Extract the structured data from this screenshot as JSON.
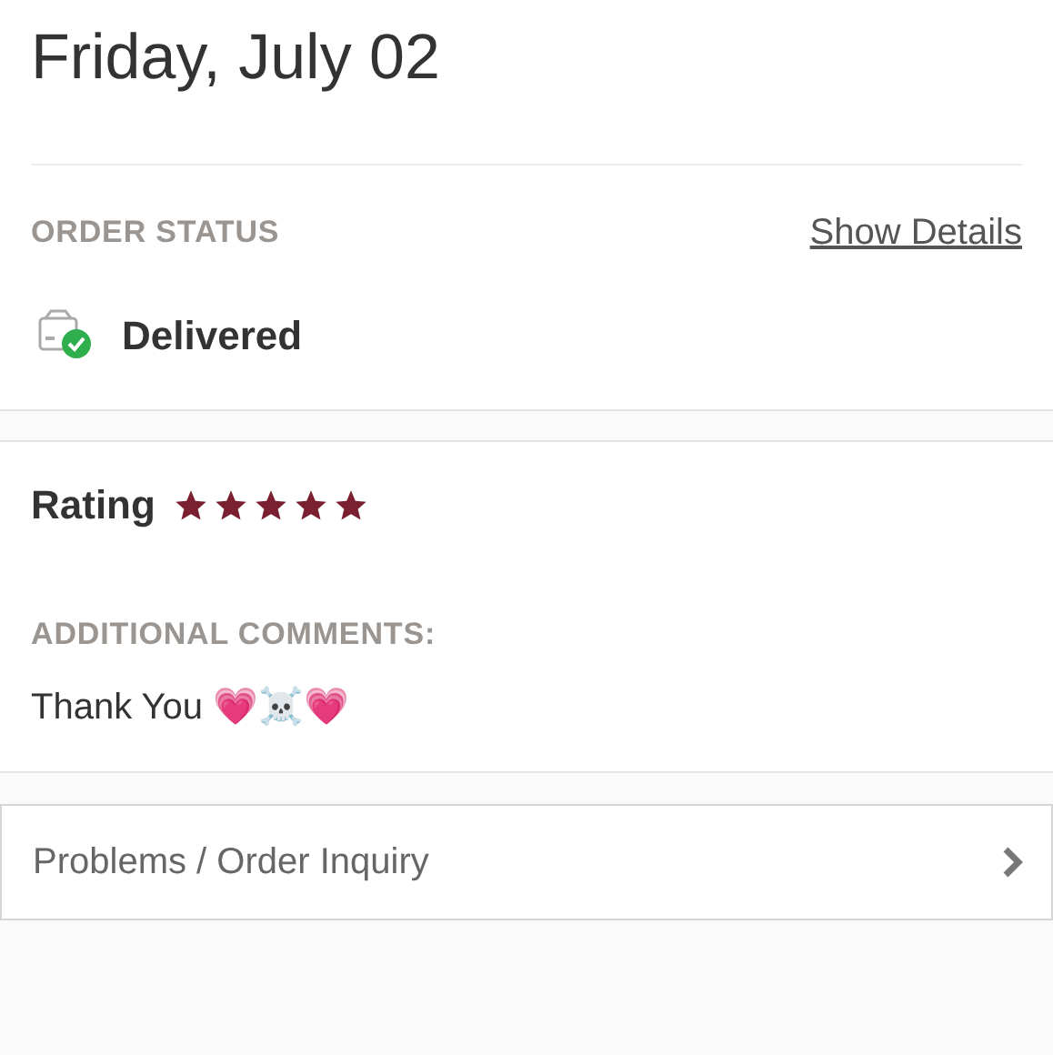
{
  "date_heading": "Friday, July 02",
  "order_status": {
    "label": "ORDER STATUS",
    "link": "Show Details",
    "status": "Delivered"
  },
  "rating": {
    "label": "Rating",
    "stars": 5
  },
  "comments": {
    "label": "ADDITIONAL COMMENTS:",
    "text": "Thank You 💗☠️💗"
  },
  "inquiry_button": {
    "label": "Problems / Order Inquiry"
  }
}
